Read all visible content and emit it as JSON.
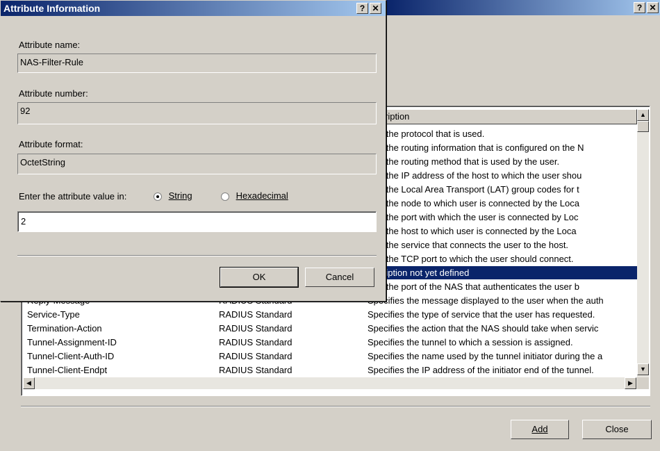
{
  "back_window": {
    "help_btn": "?",
    "close_btn": "✕",
    "column_header_description": "ription",
    "rows": [
      {
        "name": "",
        "vendor": "",
        "desc": "ifies the protocol that is used."
      },
      {
        "name": "",
        "vendor": "",
        "desc": "ifies the routing information that is configured on the N"
      },
      {
        "name": "",
        "vendor": "",
        "desc": "ifies the routing method that is used by the user."
      },
      {
        "name": "",
        "vendor": "",
        "desc": "ifies the IP address of the host to which the user shou"
      },
      {
        "name": "",
        "vendor": "",
        "desc": "ifies the Local Area Transport (LAT) group codes for t"
      },
      {
        "name": "",
        "vendor": "",
        "desc": "ifies the node to which user is connected by the Loca"
      },
      {
        "name": "",
        "vendor": "",
        "desc": "ifies the port with which the user is connected by Loc"
      },
      {
        "name": "",
        "vendor": "",
        "desc": "ifies the host to which user is connected by the Loca"
      },
      {
        "name": "",
        "vendor": "",
        "desc": "ifies the service that connects the user to the host."
      },
      {
        "name": "",
        "vendor": "",
        "desc": "ifies the TCP port to which the user should connect."
      },
      {
        "name": "",
        "vendor": "",
        "desc": "ription not yet defined",
        "selected": true
      },
      {
        "name": "",
        "vendor": "",
        "desc": "ifies the port of the NAS that authenticates the user b"
      },
      {
        "name": "Reply-Message",
        "vendor": "RADIUS Standard",
        "desc": "Specifies the message displayed to the user when the auth"
      },
      {
        "name": "Service-Type",
        "vendor": "RADIUS Standard",
        "desc": "Specifies the type of service that the user has requested."
      },
      {
        "name": "Termination-Action",
        "vendor": "RADIUS Standard",
        "desc": "Specifies the action that the NAS should take when servic"
      },
      {
        "name": "Tunnel-Assignment-ID",
        "vendor": "RADIUS Standard",
        "desc": "Specifies the tunnel to which a session is assigned."
      },
      {
        "name": "Tunnel-Client-Auth-ID",
        "vendor": "RADIUS Standard",
        "desc": "Specifies the name used by the tunnel initiator during the a"
      },
      {
        "name": "Tunnel-Client-Endpt",
        "vendor": "RADIUS Standard",
        "desc": "Specifies the IP address of the initiator end of the tunnel."
      }
    ],
    "add_label": "Add",
    "close_label": "Close"
  },
  "dialog": {
    "title": "Attribute Information",
    "help_btn": "?",
    "close_btn": "✕",
    "attr_name_label": "Attribute name:",
    "attr_name_value": "NAS-Filter-Rule",
    "attr_number_label": "Attribute number:",
    "attr_number_value": "92",
    "attr_format_label": "Attribute format:",
    "attr_format_value": "OctetString",
    "enter_label": "Enter the attribute value in:",
    "radio_string": "String",
    "radio_hex": "Hexadecimal",
    "value_input": "2",
    "ok_label": "OK",
    "cancel_label": "Cancel"
  }
}
